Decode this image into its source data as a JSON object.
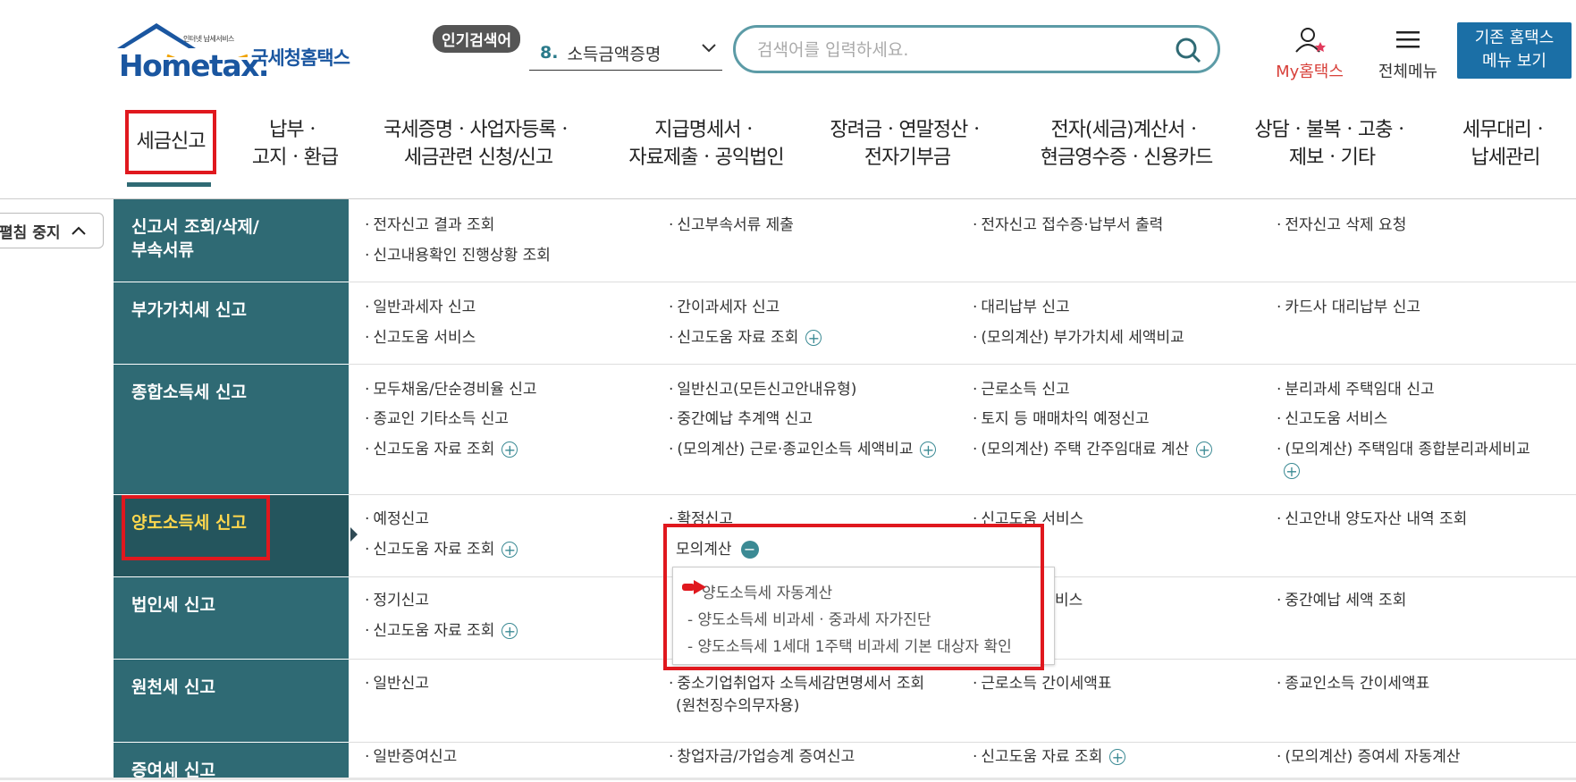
{
  "header": {
    "logo_sub": "인터넷 납세서비스",
    "logo_brand": "Hometax.",
    "logo_kor": "국세청홈택스",
    "popular_tag": "인기검색어",
    "popular_num": "8.",
    "popular_text": "소득금액증명",
    "search_placeholder": "검색어를 입력하세요.",
    "myhome_label": "My홈택스",
    "allmenu_label": "전체메뉴",
    "oldhome_line1": "기존 홈택스",
    "oldhome_line2": "메뉴 보기"
  },
  "nav": [
    {
      "l1": "세금신고",
      "l2": ""
    },
    {
      "l1": "납부ㆍ",
      "l2": "고지ㆍ환급"
    },
    {
      "l1": "국세증명ㆍ사업자등록ㆍ",
      "l2": "세금관련 신청/신고"
    },
    {
      "l1": "지급명세서ㆍ",
      "l2": "자료제출ㆍ공익법인"
    },
    {
      "l1": "장려금ㆍ연말정산ㆍ",
      "l2": "전자기부금"
    },
    {
      "l1": "전자(세금)계산서ㆍ",
      "l2": "현금영수증ㆍ신용카드"
    },
    {
      "l1": "상담ㆍ불복ㆍ고충ㆍ",
      "l2": "제보ㆍ기타"
    },
    {
      "l1": "세무대리ㆍ",
      "l2": "납세관리"
    }
  ],
  "fold_label": "펼침 중지",
  "rows": [
    {
      "head1": "신고서 조회/삭제/",
      "head2": "부속서류",
      "items": [
        "전자신고 결과 조회",
        "신고부속서류 제출",
        "전자신고 접수증·납부서 출력",
        "전자신고 삭제 요청",
        "신고내용확인 진행상황 조회"
      ]
    },
    {
      "head1": "부가가치세 신고",
      "items": [
        "일반과세자 신고",
        "간이과세자 신고",
        "대리납부 신고",
        "카드사 대리납부 신고",
        "신고도움 서비스",
        "신고도움 자료 조회",
        "(모의계산) 부가가치세 세액비교"
      ]
    },
    {
      "head1": "종합소득세 신고",
      "items": [
        "모두채움/단순경비율 신고",
        "일반신고(모든신고안내유형)",
        "근로소득 신고",
        "분리과세 주택임대 신고",
        "종교인 기타소득 신고",
        "중간예납 추계액 신고",
        "토지 등 매매차익 예정신고",
        "신고도움 서비스",
        "신고도움 자료 조회",
        "(모의계산) 근로·종교인소득 세액비교",
        "(모의계산) 주택 간주임대료 계산",
        "(모의계산) 주택임대 종합분리과세비교"
      ]
    },
    {
      "head1": "양도소득세 신고",
      "items": [
        "예정신고",
        "확정신고",
        "신고도움 서비스",
        "신고안내 양도자산 내역 조회",
        "신고도움 자료 조회",
        "모의계산"
      ]
    },
    {
      "head1": "법인세 신고",
      "items": [
        "정기신고",
        "비스",
        "중간예납 세액 조회",
        "신고도움 자료 조회"
      ]
    },
    {
      "head1": "원천세 신고",
      "items": [
        "일반신고",
        "중소기업취업자 소득세감면명세서 조회",
        "(원천징수의무자용)",
        "근로소득 간이세액표",
        "종교인소득 간이세액표"
      ]
    },
    {
      "head1": "증여세 신고",
      "items": [
        "일반증여신고",
        "창업자금/가업승계 증여신고",
        "신고도움 자료 조회",
        "(모의계산) 증여세 자동계산"
      ]
    }
  ],
  "popup_items": [
    "양도소득세 자동계산",
    "- 양도소득세 비과세ㆍ중과세 자가진단",
    "- 양도소득세 1세대 1주택 비과세 기본 대상자 확인"
  ],
  "colors": {
    "teal": "#2f6a74",
    "highlight": "#e0181e",
    "selected_text": "#ffd84d"
  }
}
